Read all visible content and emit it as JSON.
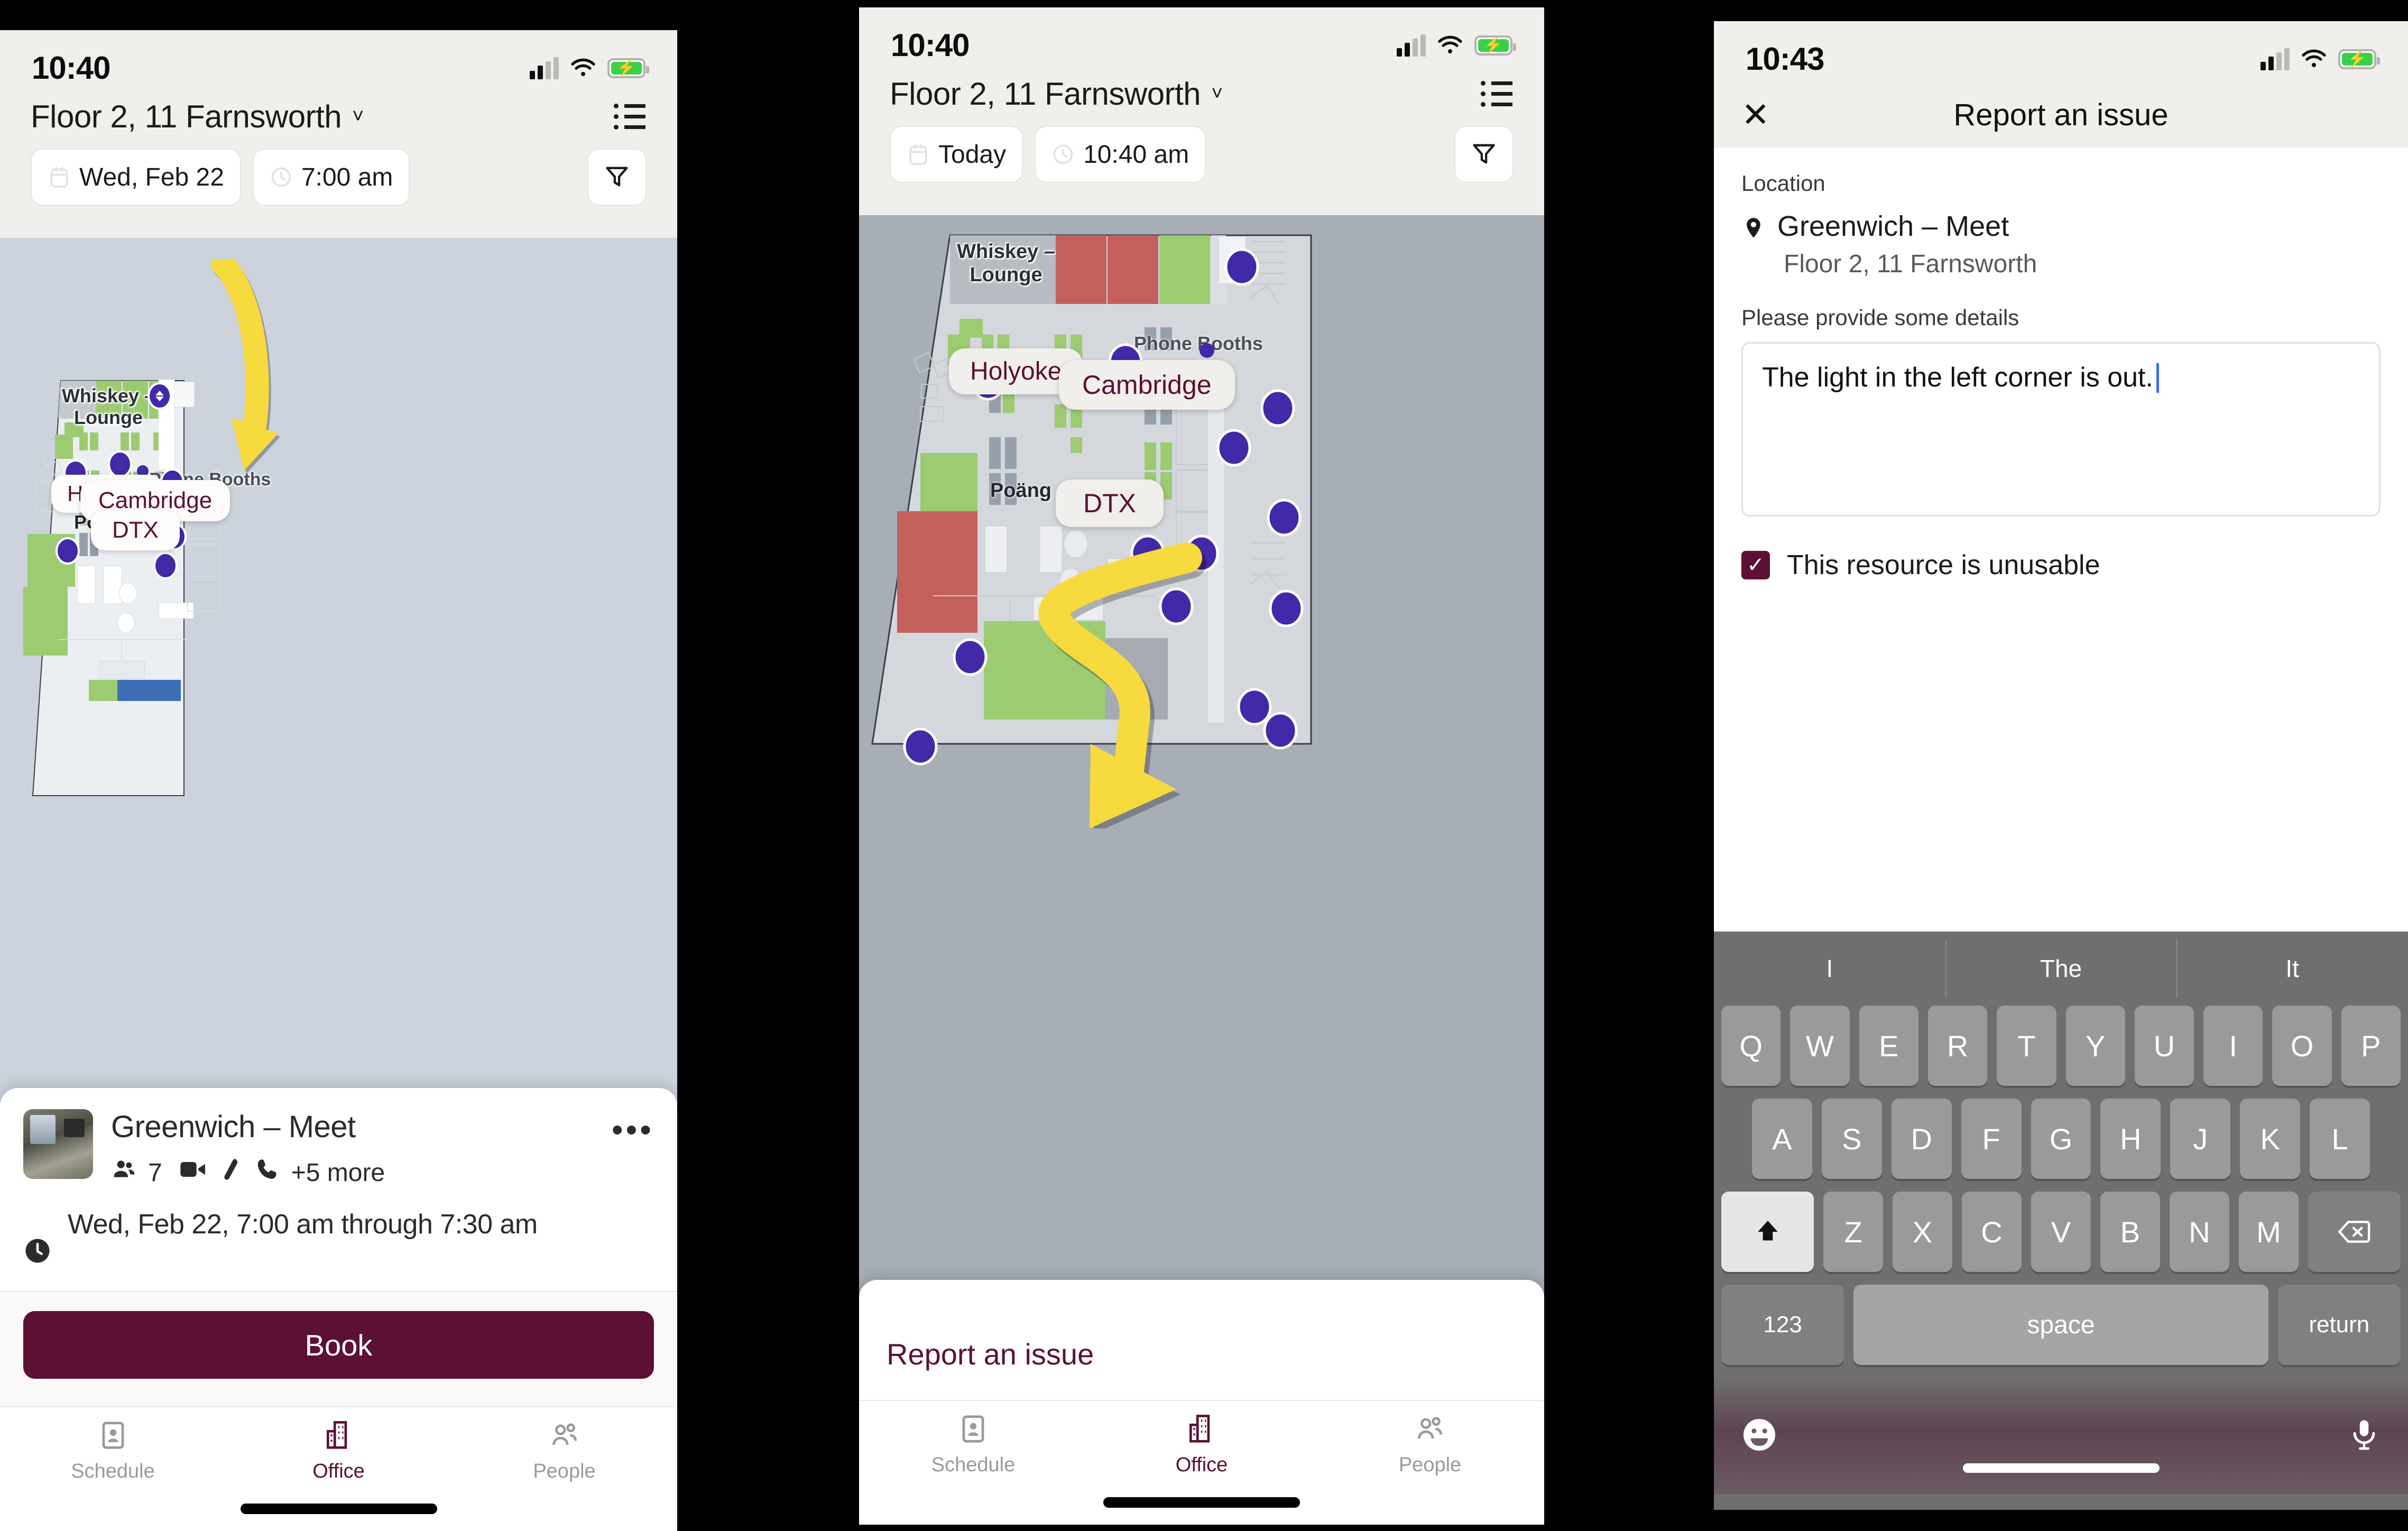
{
  "colors": {
    "accent": "#5b1034",
    "brand_purple": "#4129a8",
    "arrow_yellow": "#f7da3e",
    "map_bg": "#ccd3dc",
    "map_bg_dim": "#a8aeb6",
    "chrome_bg": "#f0efeb",
    "green_desk": "#9ccb72",
    "red_desk": "#c4605c"
  },
  "panel1": {
    "status": {
      "time": "10:40",
      "signal_icon": "signal-bars-icon",
      "wifi_icon": "wifi-icon",
      "battery_icon": "battery-charging-icon"
    },
    "header": {
      "title": "Floor 2, 11 Farnsworth",
      "chevron": "˅",
      "list_icon": "list-view-icon"
    },
    "filters": {
      "date_chip": "Wed, Feb 22",
      "time_chip": "7:00 am",
      "date_icon": "calendar-icon",
      "time_icon": "clock-icon",
      "filter_icon": "filter-funnel-icon"
    },
    "map": {
      "labels": [
        {
          "text": "Whiskey – Lounge",
          "kind": "zone"
        },
        {
          "text": "Phone Booths",
          "kind": "zone"
        },
        {
          "text": "Poäng",
          "kind": "zone"
        },
        {
          "text": "Holyoke",
          "kind": "pill"
        },
        {
          "text": "Cambridge",
          "kind": "pill"
        },
        {
          "text": "DTX",
          "kind": "pill"
        }
      ]
    },
    "card": {
      "title": "Greenwich – Meet",
      "capacity": "7",
      "amenities_more": "+5 more",
      "amenity_icons": [
        "people-icon",
        "video-camera-icon",
        "whiteboard-marker-icon",
        "phone-icon"
      ],
      "overflow_icon": "more-options-icon",
      "time_icon": "clock-icon",
      "time_text": "Wed, Feb 22, 7:00 am through 7:30 am",
      "book_label": "Book"
    },
    "tabs": [
      {
        "label": "Schedule",
        "icon": "badge-icon",
        "active": false
      },
      {
        "label": "Office",
        "icon": "building-icon",
        "active": true
      },
      {
        "label": "People",
        "icon": "people-icon",
        "active": false
      }
    ]
  },
  "panel2": {
    "status": {
      "time": "10:40"
    },
    "header": {
      "title": "Floor 2, 11 Farnsworth"
    },
    "filters": {
      "date_chip": "Today",
      "time_chip": "10:40 am"
    },
    "map": {
      "labels": [
        {
          "text": "Whiskey – Lounge",
          "kind": "zone"
        },
        {
          "text": "Phone Booths",
          "kind": "zone"
        },
        {
          "text": "Poäng",
          "kind": "zone"
        },
        {
          "text": "Holyoke",
          "kind": "pill"
        },
        {
          "text": "Cambridge",
          "kind": "pill"
        },
        {
          "text": "DTX",
          "kind": "pill"
        }
      ]
    },
    "sheet": {
      "report_label": "Report an issue"
    },
    "tabs": [
      {
        "label": "Schedule",
        "active": false
      },
      {
        "label": "Office",
        "active": true
      },
      {
        "label": "People",
        "active": false
      }
    ]
  },
  "panel3": {
    "status": {
      "time": "10:43"
    },
    "header": {
      "title": "Report an issue",
      "close_icon": "close-icon"
    },
    "form": {
      "location_label": "Location",
      "location_name": "Greenwich – Meet",
      "location_sub": "Floor 2, 11 Farnsworth",
      "pin_icon": "map-pin-icon",
      "details_label": "Please provide some details",
      "details_value": "The light in the left corner is out.",
      "checkbox_checked": true,
      "checkbox_label": "This resource is unusable",
      "check_glyph": "✓"
    },
    "keyboard": {
      "predictions": [
        "I",
        "The",
        "It"
      ],
      "row1": [
        "Q",
        "W",
        "E",
        "R",
        "T",
        "Y",
        "U",
        "I",
        "O",
        "P"
      ],
      "row2": [
        "A",
        "S",
        "D",
        "F",
        "G",
        "H",
        "J",
        "K",
        "L"
      ],
      "row3": [
        "Z",
        "X",
        "C",
        "V",
        "B",
        "N",
        "M"
      ],
      "shift_icon": "shift-arrow-icon",
      "backspace_icon": "backspace-icon",
      "numbers_label": "123",
      "space_label": "space",
      "return_label": "return",
      "emoji_icon": "emoji-smile-icon",
      "mic_icon": "microphone-icon"
    }
  }
}
